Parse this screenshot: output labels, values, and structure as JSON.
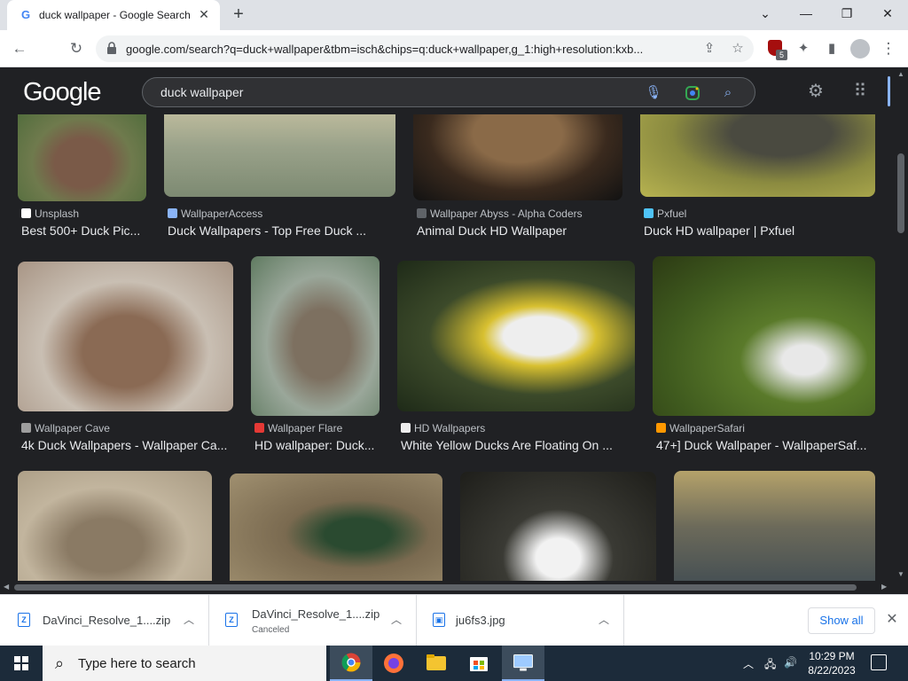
{
  "browser": {
    "tab_title": "duck wallpaper - Google Search",
    "url": "google.com/search?q=duck+wallpaper&tbm=isch&chips=q:duck+wallpaper,g_1:high+resolution:kxb...",
    "extension_badge": "5"
  },
  "google": {
    "logo": "Google",
    "query": "duck wallpaper"
  },
  "results": [
    {
      "source": "Unsplash",
      "title": "Best 500+ Duck Pic...",
      "src_color": "#ffffff"
    },
    {
      "source": "WallpaperAccess",
      "title": "Duck Wallpapers - Top Free Duck ...",
      "src_color": "#8ab4f8"
    },
    {
      "source": "Wallpaper Abyss - Alpha Coders",
      "title": "Animal Duck HD Wallpaper",
      "src_color": "#5f6368"
    },
    {
      "source": "Pxfuel",
      "title": "Duck HD wallpaper | Pxfuel",
      "src_color": "#4fc3f7"
    },
    {
      "source": "Wallpaper Cave",
      "title": "4k Duck Wallpapers - Wallpaper Ca...",
      "src_color": "#9e9e9e"
    },
    {
      "source": "Wallpaper Flare",
      "title": "HD wallpaper: Duck...",
      "src_color": "#e53935"
    },
    {
      "source": "HD Wallpapers",
      "title": "White Yellow Ducks Are Floating On ...",
      "src_color": "#eeeeee"
    },
    {
      "source": "WallpaperSafari",
      "title": "47+] Duck Wallpaper - WallpaperSaf...",
      "src_color": "#ff9800"
    }
  ],
  "downloads": [
    {
      "name": "DaVinci_Resolve_1....zip",
      "status": ""
    },
    {
      "name": "DaVinci_Resolve_1....zip",
      "status": "Canceled"
    },
    {
      "name": "ju6fs3.jpg",
      "status": ""
    }
  ],
  "download_bar": {
    "show_all": "Show all"
  },
  "taskbar": {
    "search_placeholder": "Type here to search",
    "time": "10:29 PM",
    "date": "8/22/2023"
  }
}
